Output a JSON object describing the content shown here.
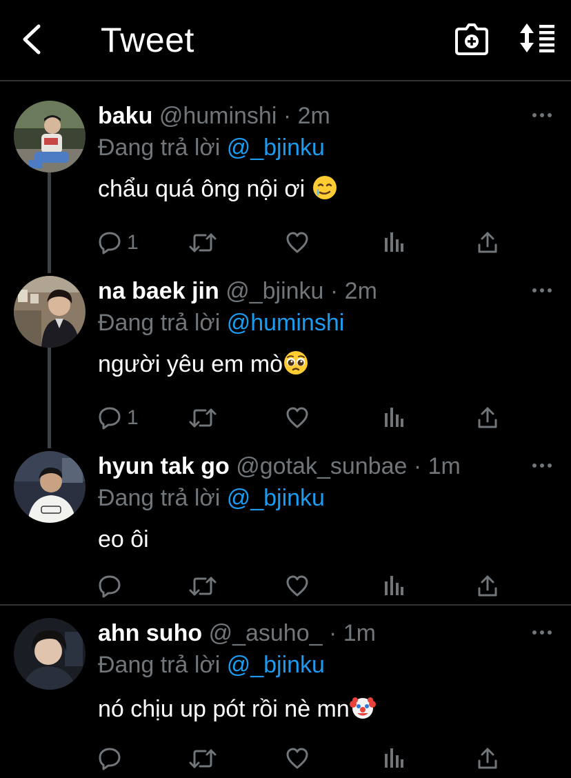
{
  "header": {
    "title": "Tweet"
  },
  "reply_prefix": "Đang trả lời ",
  "tweets": [
    {
      "name": "baku",
      "handle": "@huminshi",
      "dot": " · ",
      "time": "2m",
      "reply_to": "@_bjinku",
      "text": "chẩu quá ông nội ơi",
      "emoji": "crying-smile-emoji",
      "replies": "1"
    },
    {
      "name": "na baek jin",
      "handle": "@_bjinku",
      "dot": " · ",
      "time": "2m",
      "reply_to": "@huminshi",
      "text": "người yêu em mò",
      "emoji": "pleading-face-emoji",
      "replies": "1"
    },
    {
      "name": "hyun tak go",
      "handle": "@gotak_sunbae",
      "dot": " · ",
      "time": "1m",
      "reply_to": "@_bjinku",
      "text": "eo ôi",
      "emoji": "",
      "replies": ""
    },
    {
      "name": "ahn suho",
      "handle": "@_asuho_",
      "dot": " · ",
      "time": "1m",
      "reply_to": "@_bjinku",
      "text": "nó chịu up pót rồi nè mn",
      "emoji": "clown-face-emoji",
      "replies": ""
    }
  ],
  "icons": {
    "back": "chevron-left-icon",
    "camera": "camera-plus-icon",
    "sort": "sort-icon",
    "more": "more-horizontal-icon",
    "reply": "reply-icon",
    "retweet": "retweet-icon",
    "like": "heart-icon",
    "analytics": "analytics-icon",
    "share": "share-icon"
  },
  "colors": {
    "background": "#000000",
    "text": "#ffffff",
    "muted": "#71767b",
    "accent": "#1d9bf0",
    "divider": "#2f3336"
  }
}
